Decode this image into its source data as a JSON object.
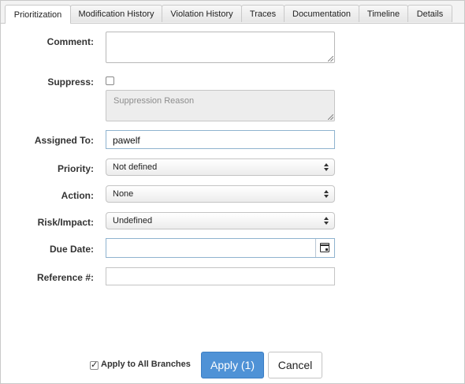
{
  "tabs": [
    {
      "label": "Prioritization",
      "active": true
    },
    {
      "label": "Modification History",
      "active": false
    },
    {
      "label": "Violation History",
      "active": false
    },
    {
      "label": "Traces",
      "active": false
    },
    {
      "label": "Documentation",
      "active": false
    },
    {
      "label": "Timeline",
      "active": false
    },
    {
      "label": "Details",
      "active": false
    }
  ],
  "form": {
    "comment_label": "Comment:",
    "comment_value": "",
    "suppress_label": "Suppress:",
    "suppress_checked": false,
    "suppression_reason_placeholder": "Suppression Reason",
    "assigned_to_label": "Assigned To:",
    "assigned_to_value": "pawelf",
    "priority_label": "Priority:",
    "priority_value": "Not defined",
    "action_label": "Action:",
    "action_value": "None",
    "risk_label": "Risk/Impact:",
    "risk_value": "Undefined",
    "due_date_label": "Due Date:",
    "due_date_value": "",
    "reference_label": "Reference #:",
    "reference_value": ""
  },
  "footer": {
    "apply_branches_label": "Apply to All Branches",
    "apply_branches_checked": true,
    "apply_button": "Apply (1)",
    "cancel_button": "Cancel"
  },
  "colors": {
    "primary_button": "#4f92d6",
    "input_border_focus": "#8fb3cf"
  }
}
